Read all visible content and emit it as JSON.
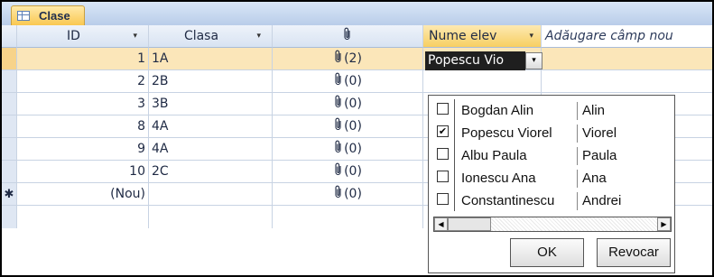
{
  "tab": {
    "icon": "table-icon",
    "label": "Clase"
  },
  "header": {
    "id": "ID",
    "clasa": "Clasa",
    "attachment_icon": "paperclip-icon",
    "nume_elev": "Nume elev",
    "add_field": "Adăugare câmp nou",
    "sort_arrow": "▾"
  },
  "rows": [
    {
      "id": "1",
      "clasa": "1A",
      "attach": "(2)",
      "nume": "Popescu Viorel"
    },
    {
      "id": "2",
      "clasa": "2B",
      "attach": "(0)",
      "nume": ""
    },
    {
      "id": "3",
      "clasa": "3B",
      "attach": "(0)",
      "nume": ""
    },
    {
      "id": "8",
      "clasa": "4A",
      "attach": "(0)",
      "nume": ""
    },
    {
      "id": "9",
      "clasa": "4A",
      "attach": "(0)",
      "nume": ""
    },
    {
      "id": "10",
      "clasa": "2C",
      "attach": "(0)",
      "nume": ""
    }
  ],
  "new_row": {
    "marker": "✱",
    "id": "(Nou)",
    "attach": "(0)"
  },
  "combo": {
    "value": "Popescu Vio",
    "arrow": "▾"
  },
  "dropdown": {
    "items": [
      {
        "name": "Bogdan Alin",
        "first": "Alin",
        "checked": false
      },
      {
        "name": "Popescu Viorel",
        "first": "Viorel",
        "checked": true
      },
      {
        "name": "Albu Paula",
        "first": "Paula",
        "checked": false
      },
      {
        "name": "Ionescu Ana",
        "first": "Ana",
        "checked": false
      },
      {
        "name": "Constantinescu",
        "first": "Andrei",
        "checked": false
      }
    ],
    "ok_label": "OK",
    "cancel_label": "Revocar",
    "check_mark": "✔"
  },
  "clip_glyph": "⌇"
}
